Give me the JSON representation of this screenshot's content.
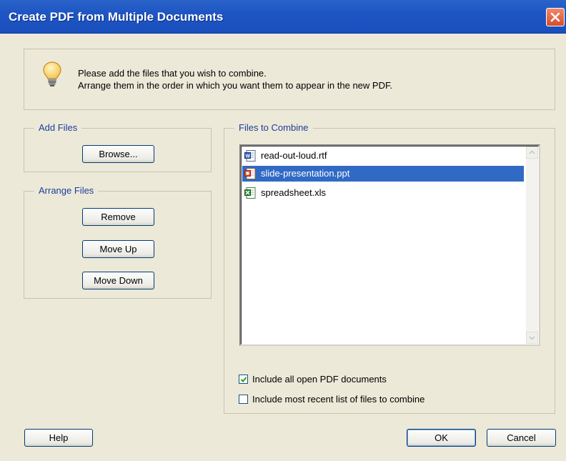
{
  "window": {
    "title": "Create PDF from Multiple Documents"
  },
  "info": {
    "line1": "Please add the files that you wish to combine.",
    "line2": "Arrange them in the order in which you want them to appear in the new PDF."
  },
  "add_files": {
    "legend": "Add Files",
    "browse_label": "Browse..."
  },
  "arrange_files": {
    "legend": "Arrange Files",
    "remove_label": "Remove",
    "move_up_label": "Move Up",
    "move_down_label": "Move Down"
  },
  "files_to_combine": {
    "legend": "Files to Combine",
    "items": [
      {
        "name": "read-out-loud.rtf",
        "icon": "word-document-icon",
        "selected": false
      },
      {
        "name": "slide-presentation.ppt",
        "icon": "powerpoint-icon",
        "selected": true
      },
      {
        "name": "spreadsheet.xls",
        "icon": "excel-icon",
        "selected": false
      }
    ]
  },
  "options": {
    "include_open_pdf": {
      "label": "Include all open PDF documents",
      "checked": true
    },
    "include_recent": {
      "label": "Include most recent list of files to combine",
      "checked": false
    }
  },
  "footer": {
    "help_label": "Help",
    "ok_label": "OK",
    "cancel_label": "Cancel"
  },
  "colors": {
    "titlebar": "#1e55c4",
    "dialog_bg": "#ece9d8",
    "selection": "#316ac5",
    "legend_text": "#1c3e9c"
  }
}
